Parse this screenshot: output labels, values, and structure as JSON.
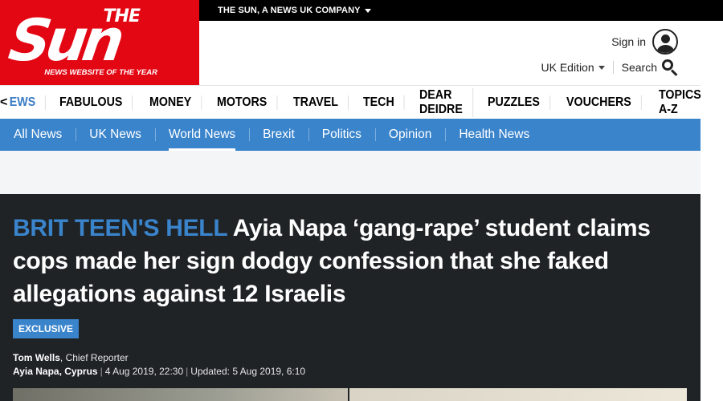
{
  "top_bar": {
    "company_label": "THE SUN, A NEWS UK COMPANY"
  },
  "logo": {
    "the": "THE",
    "sun": "Sun",
    "tagline": "NEWS WEBSITE OF THE YEAR"
  },
  "header": {
    "sign_in": "Sign in",
    "edition": "UK Edition",
    "search": "Search"
  },
  "nav_main": {
    "back": "<",
    "items": [
      "EWS",
      "FABULOUS",
      "MONEY",
      "MOTORS",
      "TRAVEL",
      "TECH",
      "DEAR DEIDRE",
      "PUZZLES",
      "VOUCHERS",
      "TOPICS A-Z"
    ]
  },
  "nav_sub": {
    "items": [
      "All News",
      "UK News",
      "World News",
      "Brexit",
      "Politics",
      "Opinion",
      "Health News"
    ],
    "active": "World News"
  },
  "article": {
    "kicker": "BRIT TEEN'S HELL",
    "headline": "Ayia Napa ‘gang-rape’ student claims cops made her sign dodgy confession that she faked allegations against 12 Israelis",
    "badge": "EXCLUSIVE",
    "author": "Tom Wells",
    "author_role": ", Chief Reporter",
    "location": "Ayia Napa, Cyprus",
    "published": "4 Aug 2019, 22:30",
    "updated": "Updated: 5 Aug 2019, 6:10"
  },
  "colors": {
    "brand_red": "#e30613",
    "accent_blue": "#3a84cc",
    "article_bg": "#1f2326"
  }
}
